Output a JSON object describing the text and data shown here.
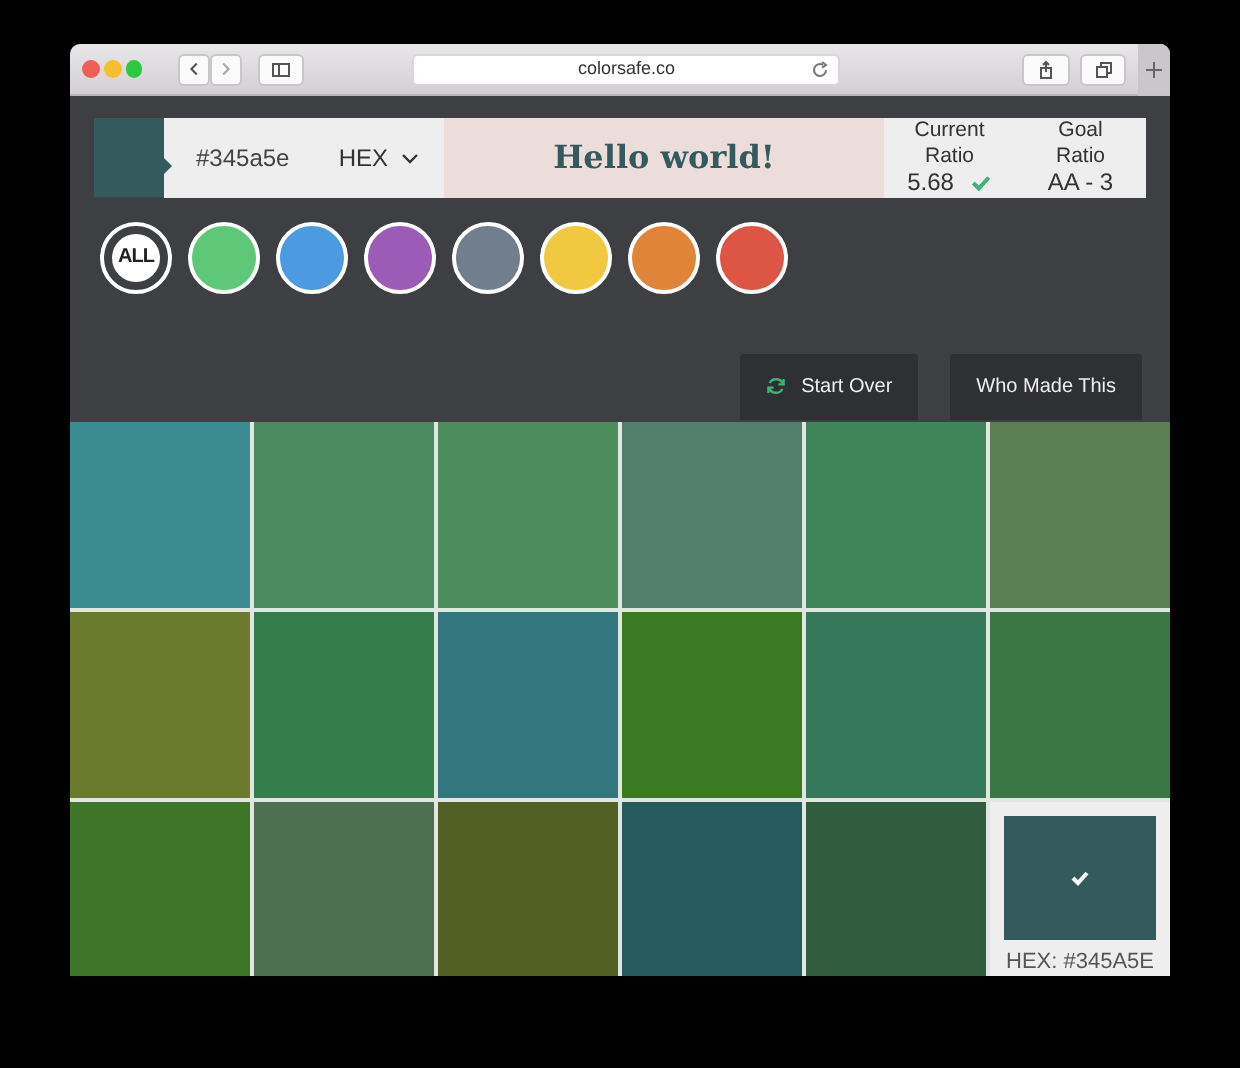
{
  "browser": {
    "url": "colorsafe.co"
  },
  "color_input": {
    "hex": "#345a5e",
    "format": "HEX"
  },
  "preview": {
    "text": "Hello world!"
  },
  "ratios": [
    {
      "label": "Current Ratio",
      "value": "5.68",
      "passes": true
    },
    {
      "label": "Goal Ratio",
      "value": "AA - 3"
    }
  ],
  "filters": [
    {
      "kind": "all",
      "label": "ALL",
      "selected": true
    },
    {
      "kind": "color",
      "color": "#5fc878",
      "selected": false
    },
    {
      "kind": "color",
      "color": "#4c9be0",
      "selected": false
    },
    {
      "kind": "color",
      "color": "#9b5bb6",
      "selected": false
    },
    {
      "kind": "color",
      "color": "#717e8d",
      "selected": false
    },
    {
      "kind": "color",
      "color": "#f0c941",
      "selected": false
    },
    {
      "kind": "color",
      "color": "#e0843a",
      "selected": false
    },
    {
      "kind": "color",
      "color": "#dd5645",
      "selected": false
    }
  ],
  "buttons": [
    {
      "kind": "refresh",
      "label": "Start Over"
    },
    {
      "kind": "plain",
      "label": "Who Made This"
    }
  ],
  "swatches": [
    {
      "color": "#3d8b92",
      "selected": false
    },
    {
      "color": "#4b8a5e",
      "selected": false
    },
    {
      "color": "#4d8c5c",
      "selected": false
    },
    {
      "color": "#527f6c",
      "selected": false
    },
    {
      "color": "#40845a",
      "selected": false
    },
    {
      "color": "#5b7f52",
      "selected": false
    },
    {
      "color": "#6b7a2c",
      "selected": false
    },
    {
      "color": "#357e4c",
      "selected": false
    },
    {
      "color": "#34767e",
      "selected": false
    },
    {
      "color": "#3a7a22",
      "selected": false
    },
    {
      "color": "#35795a",
      "selected": false
    },
    {
      "color": "#3a7745",
      "selected": false
    },
    {
      "color": "#3e7528",
      "selected": false
    },
    {
      "color": "#4f7050",
      "selected": false
    },
    {
      "color": "#525f24",
      "selected": false
    },
    {
      "color": "#265a5e",
      "selected": false
    },
    {
      "color": "#305d3e",
      "selected": false
    },
    {
      "color": "#345a5e",
      "selected": true,
      "label": "HEX: #345A5E"
    }
  ]
}
